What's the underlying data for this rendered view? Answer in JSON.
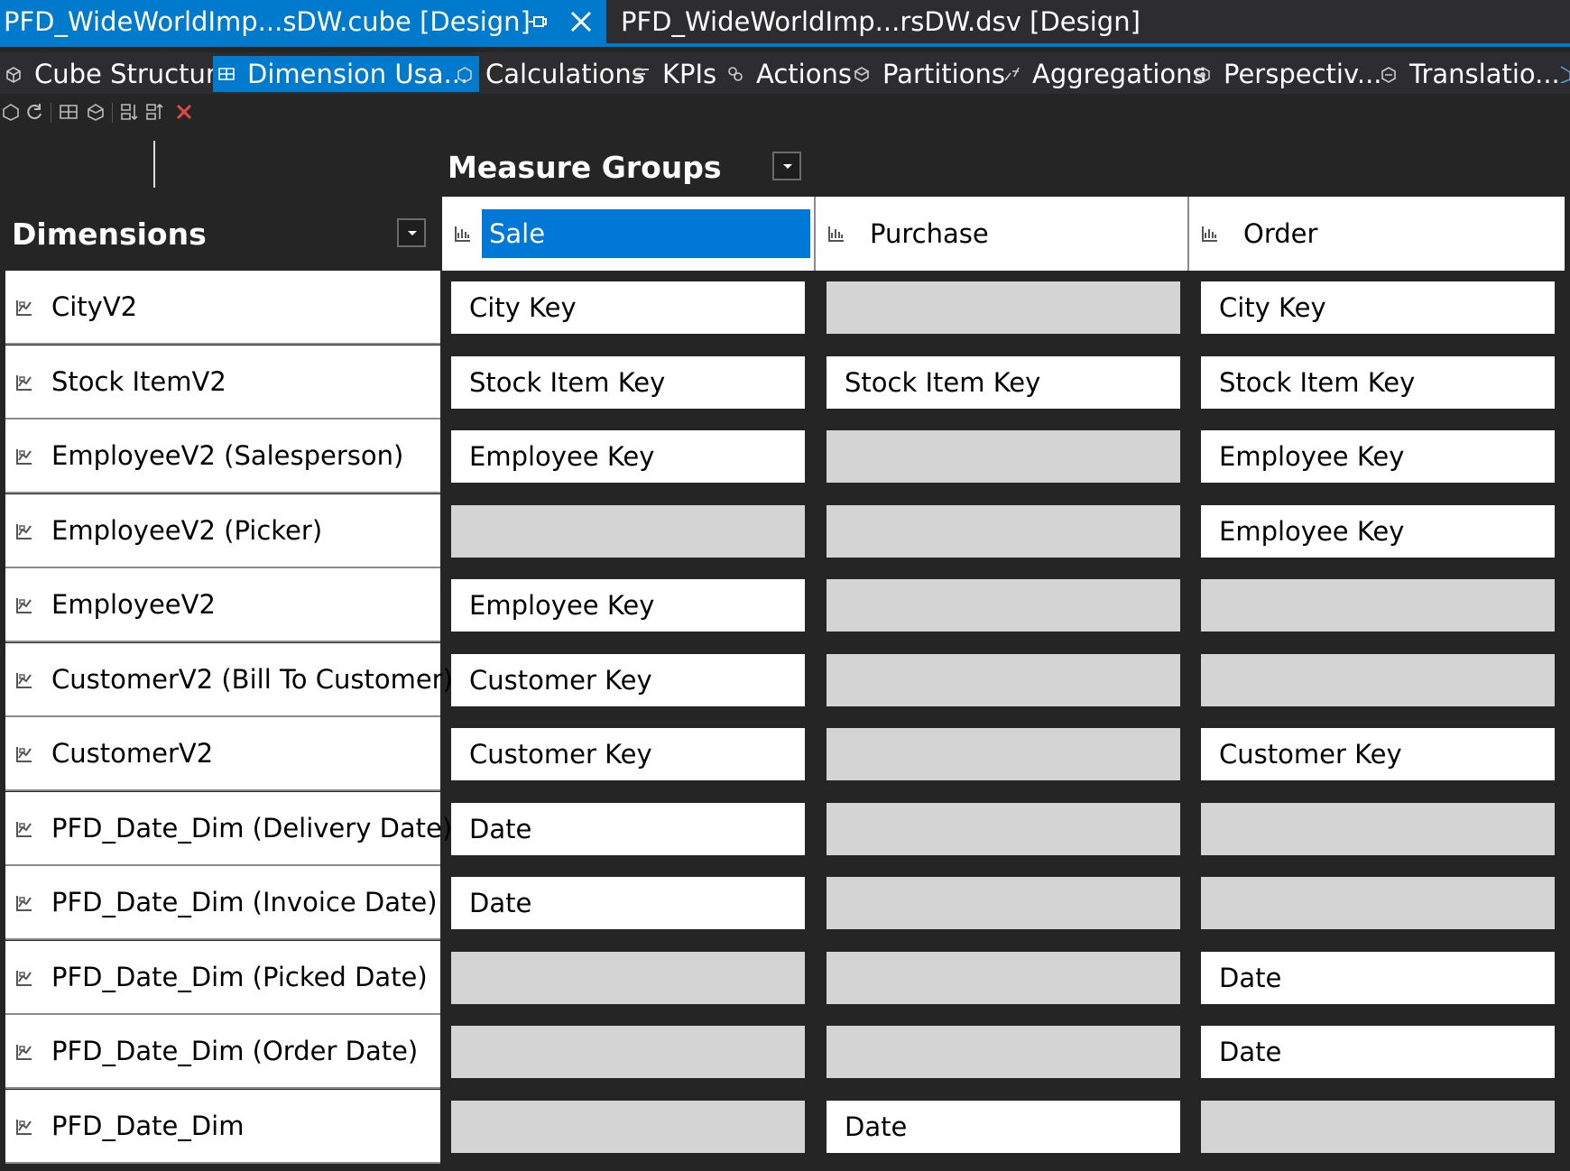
{
  "document_tabs": [
    {
      "title": "PFD_WideWorldImp...sDW.cube [Design]",
      "active": true
    },
    {
      "title": "PFD_WideWorldImp...rsDW.dsv [Design]",
      "active": false
    }
  ],
  "designer_tabs": [
    {
      "label": "Cube Structure",
      "icon": "cube-structure-icon",
      "selected": false
    },
    {
      "label": "Dimension Usa...",
      "icon": "dimension-usage-icon",
      "selected": true
    },
    {
      "label": "Calculations",
      "icon": "calculations-icon",
      "selected": false
    },
    {
      "label": "KPIs",
      "icon": "kpis-icon",
      "selected": false
    },
    {
      "label": "Actions",
      "icon": "actions-icon",
      "selected": false
    },
    {
      "label": "Partitions",
      "icon": "partitions-icon",
      "selected": false
    },
    {
      "label": "Aggregations",
      "icon": "aggregations-icon",
      "selected": false
    },
    {
      "label": "Perspectiv...",
      "icon": "perspectives-icon",
      "selected": false
    },
    {
      "label": "Translatio...",
      "icon": "translations-icon",
      "selected": false
    }
  ],
  "headers": {
    "measure_groups": "Measure Groups",
    "dimensions": "Dimensions"
  },
  "measure_groups": [
    {
      "name": "Sale",
      "selected": true
    },
    {
      "name": "Purchase",
      "selected": false
    },
    {
      "name": "Order",
      "selected": false
    }
  ],
  "dimensions": [
    {
      "name": "CityV2",
      "cells": [
        "City Key",
        "",
        "City Key"
      ]
    },
    {
      "name": "Stock ItemV2",
      "cells": [
        "Stock Item Key",
        "Stock Item Key",
        "Stock Item Key"
      ]
    },
    {
      "name": "EmployeeV2 (Salesperson)",
      "cells": [
        "Employee Key",
        "",
        "Employee Key"
      ]
    },
    {
      "name": "EmployeeV2 (Picker)",
      "cells": [
        "",
        "",
        "Employee Key"
      ]
    },
    {
      "name": "EmployeeV2",
      "cells": [
        "Employee Key",
        "",
        ""
      ]
    },
    {
      "name": "CustomerV2 (Bill To Customer)",
      "cells": [
        "Customer Key",
        "",
        ""
      ]
    },
    {
      "name": "CustomerV2",
      "cells": [
        "Customer Key",
        "",
        "Customer Key"
      ]
    },
    {
      "name": "PFD_Date_Dim (Delivery Date)",
      "cells": [
        "Date",
        "",
        ""
      ]
    },
    {
      "name": "PFD_Date_Dim (Invoice Date)",
      "cells": [
        "Date",
        "",
        ""
      ]
    },
    {
      "name": "PFD_Date_Dim (Picked Date)",
      "cells": [
        "",
        "",
        "Date"
      ]
    },
    {
      "name": "PFD_Date_Dim (Order Date)",
      "cells": [
        "",
        "",
        "Date"
      ]
    },
    {
      "name": "PFD_Date_Dim",
      "cells": [
        "",
        "Date",
        ""
      ]
    }
  ],
  "colors": {
    "accent": "#007acc",
    "selection": "#0078d7",
    "background": "#252526",
    "cell_active": "#ffffff",
    "cell_empty": "#d4d4d4"
  }
}
